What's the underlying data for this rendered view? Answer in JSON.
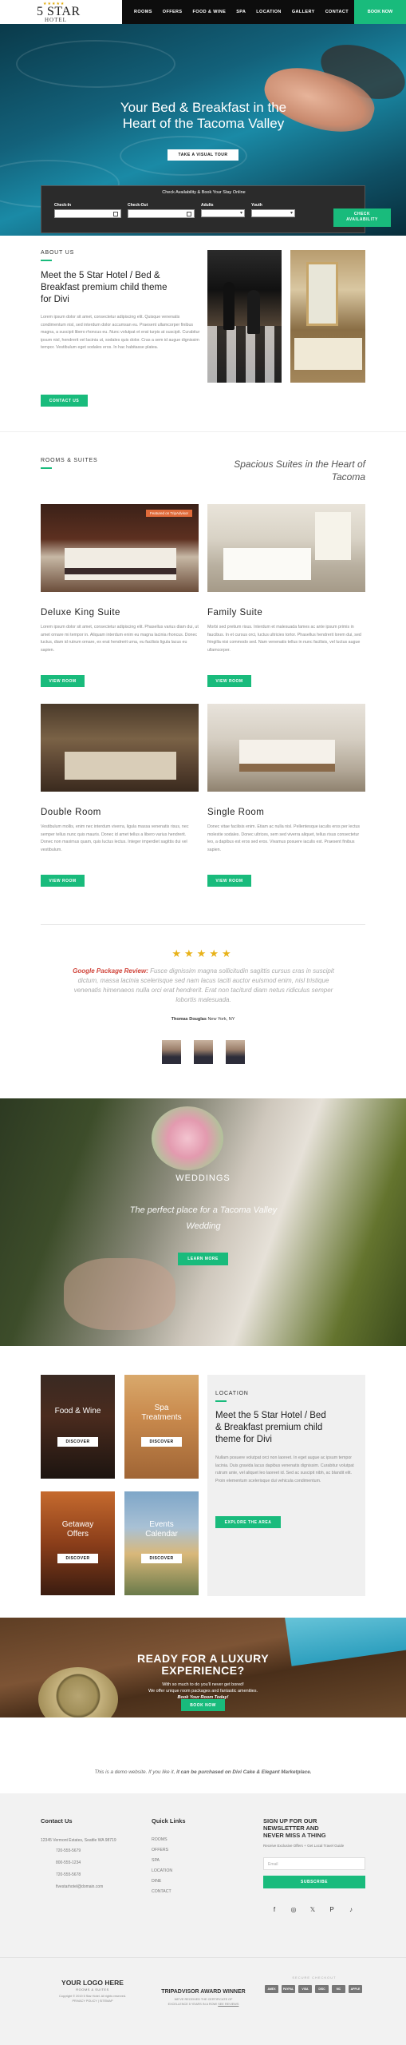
{
  "header": {
    "logo_stars": "★★★★★",
    "logo_main": "5 STAR",
    "logo_sub": "HOTEL",
    "nav": [
      "ROOMS",
      "OFFERS",
      "FOOD & WINE",
      "SPA",
      "LOCATION",
      "GALLERY",
      "CONTACT"
    ],
    "book_now": "BOOK NOW"
  },
  "hero": {
    "title_line1": "Your Bed & Breakfast in the",
    "title_line2": "Heart of the Tacoma Valley",
    "tour_button": "TAKE A VISUAL TOUR"
  },
  "booking": {
    "title": "Check Availability & Book Your Stay Online",
    "checkin_label": "Check-In",
    "checkout_label": "Check-Out",
    "adults_label": "Adults",
    "youth_label": "Youth",
    "button_line1": "CHECK",
    "button_line2": "AVAILABILITY"
  },
  "about": {
    "label": "ABOUT US",
    "title_line1": "Meet the 5 Star Hotel / Bed &",
    "title_line2": "Breakfast premium child theme",
    "title_line3": "for Divi",
    "body": "Lorem ipsum dolor sit amet, consectetur adipiscing elit. Quisque venenatis condimentum nisl, sed interdum dolor accumsan eu. Praesent ullamcorper finibus magna, a suscipit libero rhoncus eu. Nunc volutpat et erat turpis at suscipit. Curabitur ipsum nisl, hendrerit vel lacinia ut, sodales quis dolor. Cras a sem id augue dignissim tempor. Vestibulum eget sodales eros. In hac habitasse platea.",
    "button": "CONTACT US"
  },
  "rooms": {
    "label": "ROOMS & SUITES",
    "heading_line1": "Spacious Suites in the Heart of",
    "heading_line2": "Tacoma",
    "badge": "Featured on TripAdvisor",
    "items": [
      {
        "title": "Deluxe King Suite",
        "text": "Lorem ipsum dolor sit amet, consectetur adipiscing elit. Phasellus varius diam dui, ut amet ornare mi tempor in. Aliquam interdum enim eu magna lacinia rhoncus. Donec luctus, diam id rutrum ornare, ex erat hendrerit urna, eu facilisis ligula lacus eu sapien.",
        "button": "VIEW ROOM"
      },
      {
        "title": "Family Suite",
        "text": "Morbi sed pretium risus. Interdum et malesuada fames ac ante ipsum primis in faucibus. In et cursus orci, luctus ultricies tortor. Phasellus hendrerit lorem dui, sed fringilla nisi commodo sed. Nam venenatis tellus in nunc facilisis, vel luctus augue ullamcorper.",
        "button": "VIEW ROOM"
      },
      {
        "title": "Double Room",
        "text": "Vestibulum mollis, enim nec interdum viverra, ligula massa venenatis risus, nec semper tellus nunc quis mauris. Donec id amet tellus a libero varius hendrerit. Donec non maximus quam, quis luctus lectus. Integer imperdiet sagittis dui vel vestibulum.",
        "button": "VIEW ROOM"
      },
      {
        "title": "Single Room",
        "text": "Donec vitae facilisis enim. Etiam ac nulla nisl. Pellentesque iaculis eros per lectus molestie sodales. Donec ultrices, sem sed viverra aliquet, tellus risus consectetur leo, a dapibus est eros sed eros. Vivamus posuere iaculis est. Praesent finibus sapien.",
        "button": "VIEW ROOM"
      }
    ]
  },
  "review": {
    "stars": "★★★★★",
    "source": "Google Package Review:",
    "quote": " Fusce dignissim magna sollicitudin sagittis cursus cras in suscipit dictum, massa lacinia scelerisque sed nam lacus taciti auctor euismod enim, nisl tristique venenatis himenaeos nulla orci erat hendrerit. Erat non taciturd diam netus ridiculus semper lobortis malesuada.",
    "reviewer_name": "Thomas Douglas",
    "reviewer_location": " New York, NY"
  },
  "wedding": {
    "title": "WEDDINGS",
    "subtitle_line1": "The perfect place for a Tacoma Valley",
    "subtitle_line2": "Wedding",
    "button": "LEARN MORE"
  },
  "location": {
    "tiles": [
      {
        "title": "Food & Wine",
        "button": "DISCOVER"
      },
      {
        "title": "Spa\nTreatments",
        "button": "DISCOVER"
      },
      {
        "title": "Getaway\nOffers",
        "button": "DISCOVER"
      },
      {
        "title": "Events\nCalendar",
        "button": "DISCOVER"
      }
    ],
    "label": "LOCATION",
    "title_line1": "Meet the 5 Star Hotel / Bed",
    "title_line2": "& Breakfast premium child",
    "title_line3": "theme for Divi",
    "body": "Nullam posuere volutpat orci non laoreet. In eget augue ac ipsum tempor lacinia. Duis gravida lacus dapibus venenatis dignissim. Curabitur volutpat rutrum ante, vel aliquet leo laoreet id. Sed ac suscipit nibh, ac blandit elit. Proin elementum scelerisque dui vehicula condimentum.",
    "button": "EXPLORE THE AREA"
  },
  "luxury": {
    "title_line1": "READY FOR A LUXURY",
    "title_line2": "EXPERIENCE?",
    "text_line1": "With so much to do you'll never get bored!",
    "text_line2": "We offer unique room packages and fantastic amenities.",
    "text_line3": "Book Your Room Today!",
    "button": "BOOK NOW"
  },
  "demo_note": {
    "prefix": "This is a demo website. If you like it, ",
    "bold": "it can be purchased on Divi Cake & Elegant Marketplace."
  },
  "footer": {
    "contact_title": "Contact Us",
    "address": "12345 Vermont Estates, Seattle WA 98719",
    "phones": [
      "720-555-5679",
      "800-555-1234",
      "720-555-5678"
    ],
    "email": "fivestarhotel@domain.com",
    "links_title": "Quick Links",
    "links": [
      "ROOMS",
      "OFFERS",
      "SPA",
      "LOCATION",
      "DINE",
      "CONTACT"
    ],
    "newsletter_line1": "SIGN UP FOR OUR",
    "newsletter_line2": "NEWSLETTER AND",
    "newsletter_line3": "NEVER MISS A THING",
    "newsletter_sub": "Receive Exclusive Offers + Get Local Travel Guide",
    "email_placeholder": "Email",
    "subscribe": "SUBSCRIBE",
    "social": [
      "f",
      "◎",
      "𝕏",
      "P",
      "♪"
    ],
    "logo_title": "YOUR LOGO HERE",
    "logo_sub": "ROOMS & SUITES",
    "copyright_line1": "Copyright © 2019 5 Star Hotel. All rights reserved.",
    "copyright_line2": "PRIVACY POLICY  |  SITEMAP",
    "award_title": "TRIPADVISOR AWARD WINNER",
    "award_line1": "WE'VE RECEIVED THE CERTIFICATE OF",
    "award_line2": "EXCELLENCE 5 YEARS IN A ROW!",
    "award_link": "SEE REVIEWS",
    "secure_label": "SECURE CHECKOUT",
    "payments": [
      "AMEX",
      "PAYPAL",
      "VISA",
      "DISC",
      "MC",
      "APPLE"
    ]
  },
  "colors": {
    "accent": "#19bb7c",
    "dark": "#0d0d0d",
    "review_red": "#d0443a",
    "stars": "#e8b21a"
  }
}
